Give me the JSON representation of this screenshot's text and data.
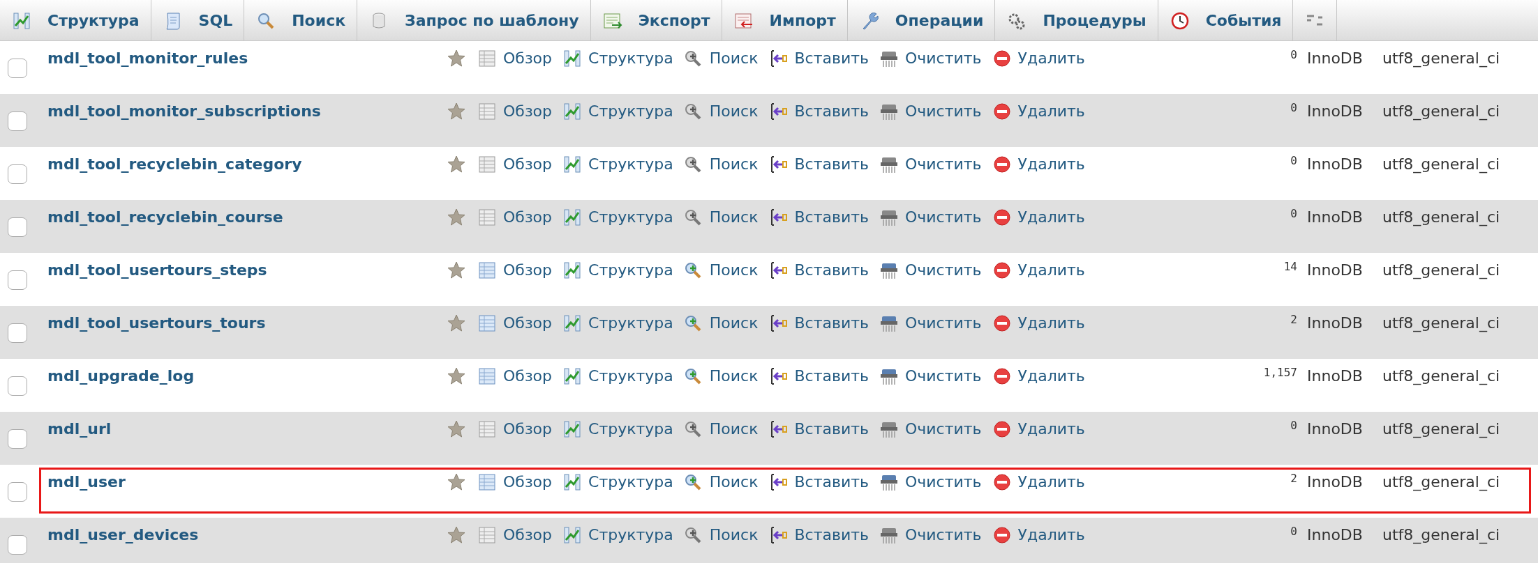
{
  "tabs": [
    {
      "label": "Структура",
      "selected": false
    },
    {
      "label": "SQL",
      "selected": false
    },
    {
      "label": "Поиск",
      "selected": false
    },
    {
      "label": "Запрос по шаблону",
      "selected": false
    },
    {
      "label": "Экспорт",
      "selected": false
    },
    {
      "label": "Импорт",
      "selected": false
    },
    {
      "label": "Операции",
      "selected": false
    },
    {
      "label": "Процедуры",
      "selected": false
    },
    {
      "label": "События",
      "selected": false
    }
  ],
  "rows": [
    {
      "name": "mdl_tool_monitor_rules",
      "checked": false,
      "empty": true,
      "highlighted": false,
      "actions": [
        "Обзор",
        "Структура",
        "Поиск",
        "Вставить",
        "Очистить",
        "Удалить"
      ],
      "row_count": "0",
      "engine": "InnoDB",
      "collation": "utf8_general_ci"
    },
    {
      "name": "mdl_tool_monitor_subscriptions",
      "checked": false,
      "empty": true,
      "highlighted": false,
      "actions": [
        "Обзор",
        "Структура",
        "Поиск",
        "Вставить",
        "Очистить",
        "Удалить"
      ],
      "row_count": "0",
      "engine": "InnoDB",
      "collation": "utf8_general_ci"
    },
    {
      "name": "mdl_tool_recyclebin_category",
      "checked": false,
      "empty": true,
      "highlighted": false,
      "actions": [
        "Обзор",
        "Структура",
        "Поиск",
        "Вставить",
        "Очистить",
        "Удалить"
      ],
      "row_count": "0",
      "engine": "InnoDB",
      "collation": "utf8_general_ci"
    },
    {
      "name": "mdl_tool_recyclebin_course",
      "checked": false,
      "empty": true,
      "highlighted": false,
      "actions": [
        "Обзор",
        "Структура",
        "Поиск",
        "Вставить",
        "Очистить",
        "Удалить"
      ],
      "row_count": "0",
      "engine": "InnoDB",
      "collation": "utf8_general_ci"
    },
    {
      "name": "mdl_tool_usertours_steps",
      "checked": false,
      "empty": false,
      "highlighted": false,
      "actions": [
        "Обзор",
        "Структура",
        "Поиск",
        "Вставить",
        "Очистить",
        "Удалить"
      ],
      "row_count": "14",
      "engine": "InnoDB",
      "collation": "utf8_general_ci"
    },
    {
      "name": "mdl_tool_usertours_tours",
      "checked": false,
      "empty": false,
      "highlighted": false,
      "actions": [
        "Обзор",
        "Структура",
        "Поиск",
        "Вставить",
        "Очистить",
        "Удалить"
      ],
      "row_count": "2",
      "engine": "InnoDB",
      "collation": "utf8_general_ci"
    },
    {
      "name": "mdl_upgrade_log",
      "checked": false,
      "empty": false,
      "highlighted": false,
      "actions": [
        "Обзор",
        "Структура",
        "Поиск",
        "Вставить",
        "Очистить",
        "Удалить"
      ],
      "row_count": "1,157",
      "engine": "InnoDB",
      "collation": "utf8_general_ci"
    },
    {
      "name": "mdl_url",
      "checked": false,
      "empty": true,
      "highlighted": false,
      "actions": [
        "Обзор",
        "Структура",
        "Поиск",
        "Вставить",
        "Очистить",
        "Удалить"
      ],
      "row_count": "0",
      "engine": "InnoDB",
      "collation": "utf8_general_ci"
    },
    {
      "name": "mdl_user",
      "checked": false,
      "empty": false,
      "highlighted": true,
      "actions": [
        "Обзор",
        "Структура",
        "Поиск",
        "Вставить",
        "Очистить",
        "Удалить"
      ],
      "row_count": "2",
      "engine": "InnoDB",
      "collation": "utf8_general_ci"
    },
    {
      "name": "mdl_user_devices",
      "checked": false,
      "empty": true,
      "highlighted": false,
      "actions": [
        "Обзор",
        "Структура",
        "Поиск",
        "Вставить",
        "Очистить",
        "Удалить"
      ],
      "row_count": "0",
      "engine": "InnoDB",
      "collation": "utf8_general_ci"
    }
  ]
}
